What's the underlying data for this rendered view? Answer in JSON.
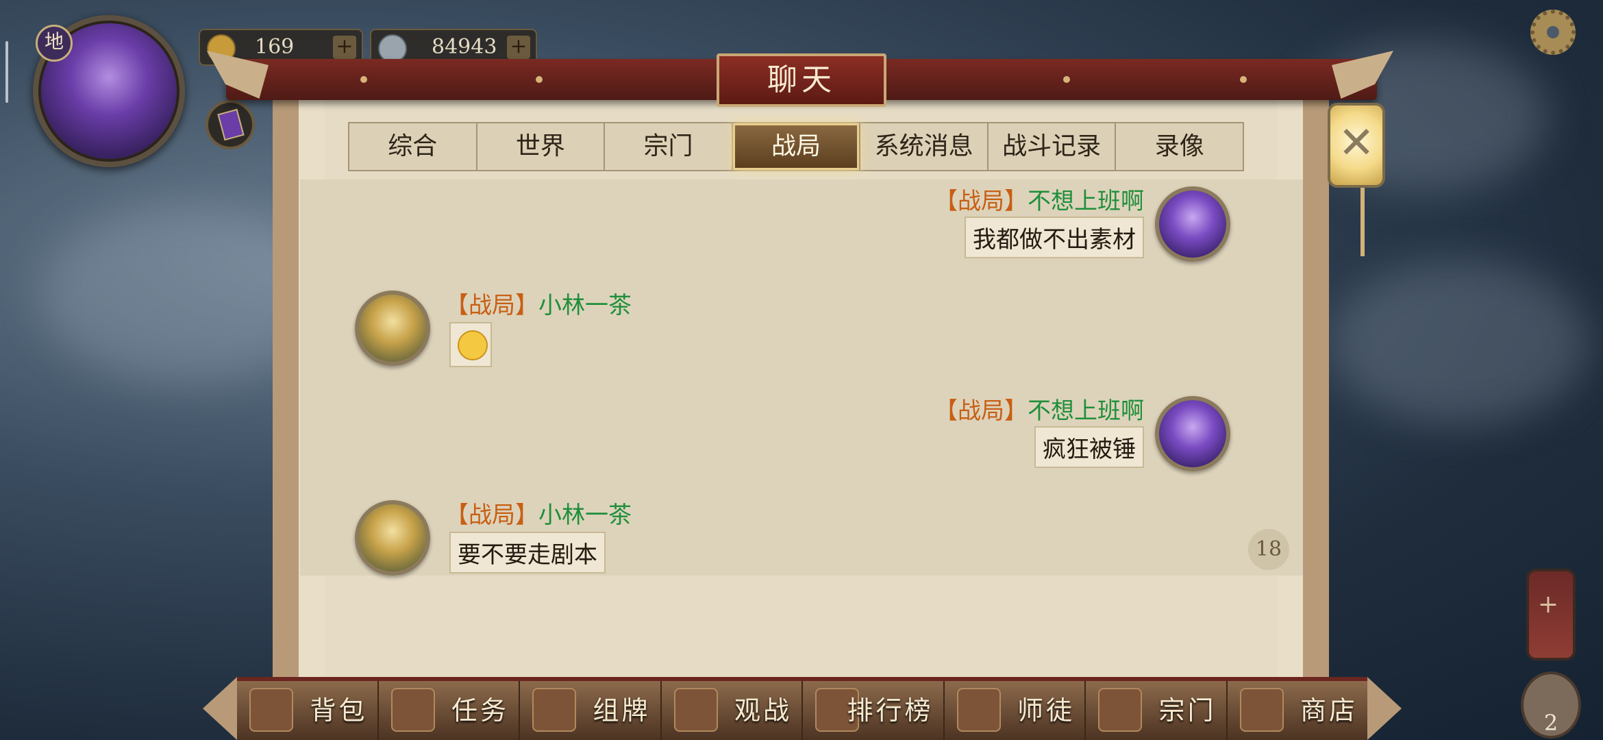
{
  "hud": {
    "rank_badge": "地",
    "currency_gold": "169",
    "currency_silver": "84943"
  },
  "panel": {
    "title": "聊天",
    "close_symbol": "✕",
    "tabs": [
      {
        "label": "综合",
        "active": false
      },
      {
        "label": "世界",
        "active": false
      },
      {
        "label": "宗门",
        "active": false
      },
      {
        "label": "战局",
        "active": true
      },
      {
        "label": "系统消息",
        "active": false
      },
      {
        "label": "战斗记录",
        "active": false
      },
      {
        "label": "录像",
        "active": false
      }
    ],
    "messages": [
      {
        "side": "right",
        "channel": "【战局】",
        "name": "不想上班啊",
        "text": "我都做不出素材"
      },
      {
        "side": "left",
        "channel": "【战局】",
        "name": "小林一茶",
        "text": "",
        "emoji": "smile"
      },
      {
        "side": "right",
        "channel": "【战局】",
        "name": "不想上班啊",
        "text": "疯狂被锤"
      },
      {
        "side": "left",
        "channel": "【战局】",
        "name": "小林一茶",
        "text": "要不要走剧本"
      }
    ],
    "unread_count": "18"
  },
  "bottom_nav": [
    {
      "label": "背包",
      "icon": "backpack-icon"
    },
    {
      "label": "任务",
      "icon": "task-scroll-icon"
    },
    {
      "label": "组牌",
      "icon": "deck-icon"
    },
    {
      "label": "观战",
      "icon": "spectate-icon"
    },
    {
      "label": "排行榜",
      "icon": "ranking-icon"
    },
    {
      "label": "师徒",
      "icon": "mentor-icon"
    },
    {
      "label": "宗门",
      "icon": "sect-icon"
    },
    {
      "label": "商店",
      "icon": "shop-icon"
    }
  ],
  "right_hud": {
    "potion_plus": "+",
    "bag_count": "2"
  },
  "colors": {
    "channel": "#c85f14",
    "name": "#1f8f3a",
    "panel_bg": "#e6dcc5",
    "frame_red": "#7a2a22"
  }
}
